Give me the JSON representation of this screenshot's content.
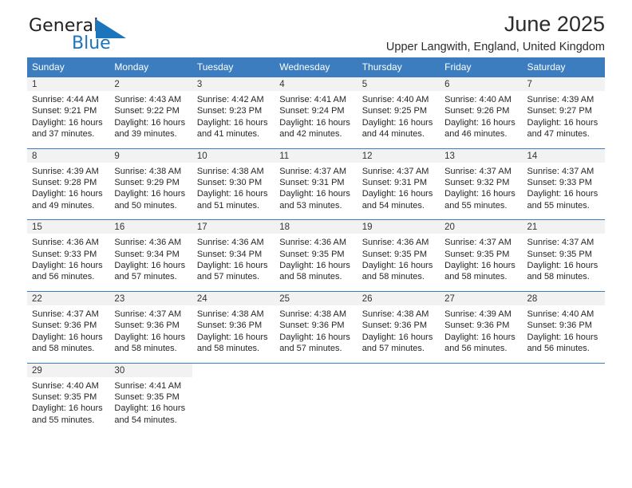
{
  "brand": {
    "name_top": "General",
    "name_bottom": "Blue",
    "accent_color": "#1b75bc"
  },
  "header": {
    "title": "June 2025",
    "subtitle": "Upper Langwith, England, United Kingdom"
  },
  "calendar": {
    "header_color": "#3b7dbf",
    "weekday_headers": [
      "Sunday",
      "Monday",
      "Tuesday",
      "Wednesday",
      "Thursday",
      "Friday",
      "Saturday"
    ],
    "weeks": [
      [
        {
          "day": "1",
          "sunrise": "Sunrise: 4:44 AM",
          "sunset": "Sunset: 9:21 PM",
          "daylight_line1": "Daylight: 16 hours",
          "daylight_line2": "and 37 minutes."
        },
        {
          "day": "2",
          "sunrise": "Sunrise: 4:43 AM",
          "sunset": "Sunset: 9:22 PM",
          "daylight_line1": "Daylight: 16 hours",
          "daylight_line2": "and 39 minutes."
        },
        {
          "day": "3",
          "sunrise": "Sunrise: 4:42 AM",
          "sunset": "Sunset: 9:23 PM",
          "daylight_line1": "Daylight: 16 hours",
          "daylight_line2": "and 41 minutes."
        },
        {
          "day": "4",
          "sunrise": "Sunrise: 4:41 AM",
          "sunset": "Sunset: 9:24 PM",
          "daylight_line1": "Daylight: 16 hours",
          "daylight_line2": "and 42 minutes."
        },
        {
          "day": "5",
          "sunrise": "Sunrise: 4:40 AM",
          "sunset": "Sunset: 9:25 PM",
          "daylight_line1": "Daylight: 16 hours",
          "daylight_line2": "and 44 minutes."
        },
        {
          "day": "6",
          "sunrise": "Sunrise: 4:40 AM",
          "sunset": "Sunset: 9:26 PM",
          "daylight_line1": "Daylight: 16 hours",
          "daylight_line2": "and 46 minutes."
        },
        {
          "day": "7",
          "sunrise": "Sunrise: 4:39 AM",
          "sunset": "Sunset: 9:27 PM",
          "daylight_line1": "Daylight: 16 hours",
          "daylight_line2": "and 47 minutes."
        }
      ],
      [
        {
          "day": "8",
          "sunrise": "Sunrise: 4:39 AM",
          "sunset": "Sunset: 9:28 PM",
          "daylight_line1": "Daylight: 16 hours",
          "daylight_line2": "and 49 minutes."
        },
        {
          "day": "9",
          "sunrise": "Sunrise: 4:38 AM",
          "sunset": "Sunset: 9:29 PM",
          "daylight_line1": "Daylight: 16 hours",
          "daylight_line2": "and 50 minutes."
        },
        {
          "day": "10",
          "sunrise": "Sunrise: 4:38 AM",
          "sunset": "Sunset: 9:30 PM",
          "daylight_line1": "Daylight: 16 hours",
          "daylight_line2": "and 51 minutes."
        },
        {
          "day": "11",
          "sunrise": "Sunrise: 4:37 AM",
          "sunset": "Sunset: 9:31 PM",
          "daylight_line1": "Daylight: 16 hours",
          "daylight_line2": "and 53 minutes."
        },
        {
          "day": "12",
          "sunrise": "Sunrise: 4:37 AM",
          "sunset": "Sunset: 9:31 PM",
          "daylight_line1": "Daylight: 16 hours",
          "daylight_line2": "and 54 minutes."
        },
        {
          "day": "13",
          "sunrise": "Sunrise: 4:37 AM",
          "sunset": "Sunset: 9:32 PM",
          "daylight_line1": "Daylight: 16 hours",
          "daylight_line2": "and 55 minutes."
        },
        {
          "day": "14",
          "sunrise": "Sunrise: 4:37 AM",
          "sunset": "Sunset: 9:33 PM",
          "daylight_line1": "Daylight: 16 hours",
          "daylight_line2": "and 55 minutes."
        }
      ],
      [
        {
          "day": "15",
          "sunrise": "Sunrise: 4:36 AM",
          "sunset": "Sunset: 9:33 PM",
          "daylight_line1": "Daylight: 16 hours",
          "daylight_line2": "and 56 minutes."
        },
        {
          "day": "16",
          "sunrise": "Sunrise: 4:36 AM",
          "sunset": "Sunset: 9:34 PM",
          "daylight_line1": "Daylight: 16 hours",
          "daylight_line2": "and 57 minutes."
        },
        {
          "day": "17",
          "sunrise": "Sunrise: 4:36 AM",
          "sunset": "Sunset: 9:34 PM",
          "daylight_line1": "Daylight: 16 hours",
          "daylight_line2": "and 57 minutes."
        },
        {
          "day": "18",
          "sunrise": "Sunrise: 4:36 AM",
          "sunset": "Sunset: 9:35 PM",
          "daylight_line1": "Daylight: 16 hours",
          "daylight_line2": "and 58 minutes."
        },
        {
          "day": "19",
          "sunrise": "Sunrise: 4:36 AM",
          "sunset": "Sunset: 9:35 PM",
          "daylight_line1": "Daylight: 16 hours",
          "daylight_line2": "and 58 minutes."
        },
        {
          "day": "20",
          "sunrise": "Sunrise: 4:37 AM",
          "sunset": "Sunset: 9:35 PM",
          "daylight_line1": "Daylight: 16 hours",
          "daylight_line2": "and 58 minutes."
        },
        {
          "day": "21",
          "sunrise": "Sunrise: 4:37 AM",
          "sunset": "Sunset: 9:35 PM",
          "daylight_line1": "Daylight: 16 hours",
          "daylight_line2": "and 58 minutes."
        }
      ],
      [
        {
          "day": "22",
          "sunrise": "Sunrise: 4:37 AM",
          "sunset": "Sunset: 9:36 PM",
          "daylight_line1": "Daylight: 16 hours",
          "daylight_line2": "and 58 minutes."
        },
        {
          "day": "23",
          "sunrise": "Sunrise: 4:37 AM",
          "sunset": "Sunset: 9:36 PM",
          "daylight_line1": "Daylight: 16 hours",
          "daylight_line2": "and 58 minutes."
        },
        {
          "day": "24",
          "sunrise": "Sunrise: 4:38 AM",
          "sunset": "Sunset: 9:36 PM",
          "daylight_line1": "Daylight: 16 hours",
          "daylight_line2": "and 58 minutes."
        },
        {
          "day": "25",
          "sunrise": "Sunrise: 4:38 AM",
          "sunset": "Sunset: 9:36 PM",
          "daylight_line1": "Daylight: 16 hours",
          "daylight_line2": "and 57 minutes."
        },
        {
          "day": "26",
          "sunrise": "Sunrise: 4:38 AM",
          "sunset": "Sunset: 9:36 PM",
          "daylight_line1": "Daylight: 16 hours",
          "daylight_line2": "and 57 minutes."
        },
        {
          "day": "27",
          "sunrise": "Sunrise: 4:39 AM",
          "sunset": "Sunset: 9:36 PM",
          "daylight_line1": "Daylight: 16 hours",
          "daylight_line2": "and 56 minutes."
        },
        {
          "day": "28",
          "sunrise": "Sunrise: 4:40 AM",
          "sunset": "Sunset: 9:36 PM",
          "daylight_line1": "Daylight: 16 hours",
          "daylight_line2": "and 56 minutes."
        }
      ],
      [
        {
          "day": "29",
          "sunrise": "Sunrise: 4:40 AM",
          "sunset": "Sunset: 9:35 PM",
          "daylight_line1": "Daylight: 16 hours",
          "daylight_line2": "and 55 minutes."
        },
        {
          "day": "30",
          "sunrise": "Sunrise: 4:41 AM",
          "sunset": "Sunset: 9:35 PM",
          "daylight_line1": "Daylight: 16 hours",
          "daylight_line2": "and 54 minutes."
        },
        {
          "day": "",
          "sunrise": "",
          "sunset": "",
          "daylight_line1": "",
          "daylight_line2": ""
        },
        {
          "day": "",
          "sunrise": "",
          "sunset": "",
          "daylight_line1": "",
          "daylight_line2": ""
        },
        {
          "day": "",
          "sunrise": "",
          "sunset": "",
          "daylight_line1": "",
          "daylight_line2": ""
        },
        {
          "day": "",
          "sunrise": "",
          "sunset": "",
          "daylight_line1": "",
          "daylight_line2": ""
        },
        {
          "day": "",
          "sunrise": "",
          "sunset": "",
          "daylight_line1": "",
          "daylight_line2": ""
        }
      ]
    ]
  }
}
